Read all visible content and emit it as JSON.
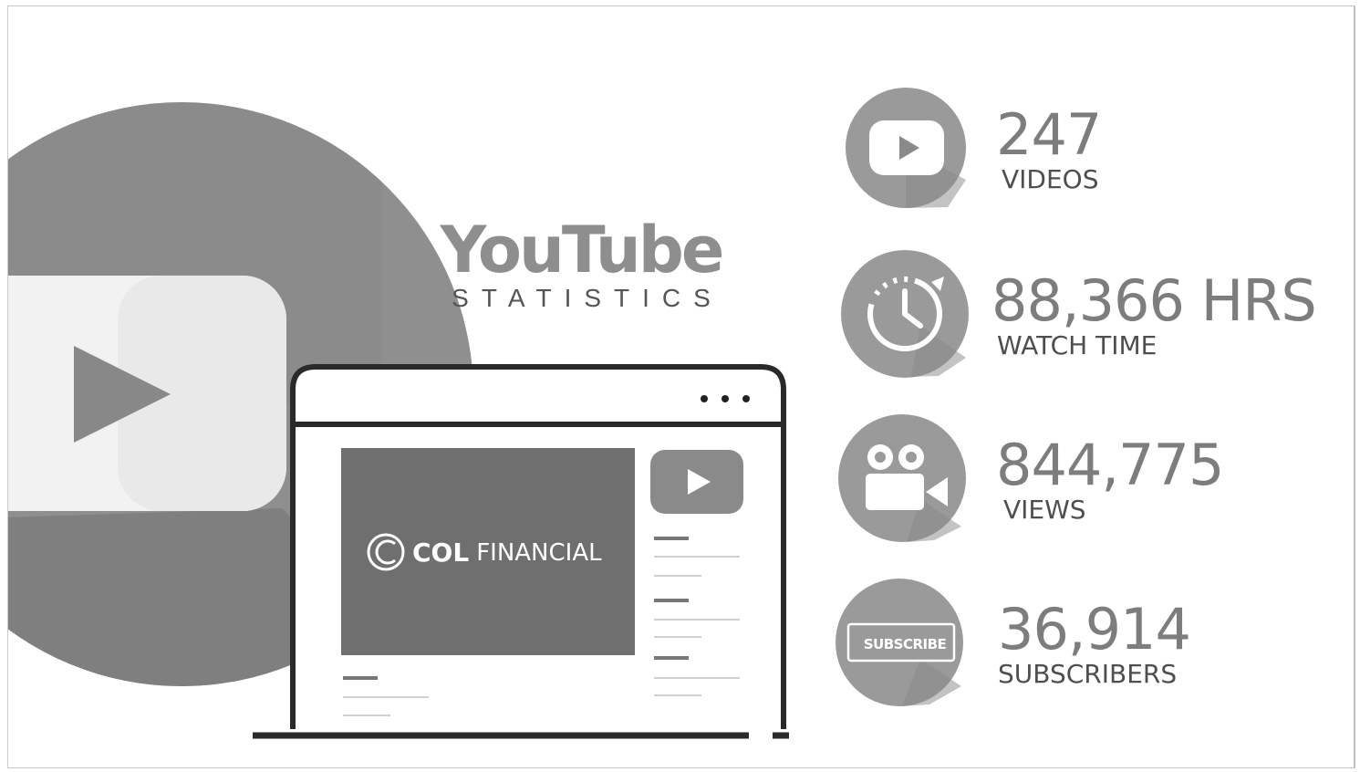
{
  "header": {
    "title": "YouTube",
    "subtitle": "STATISTICS"
  },
  "video_player": {
    "brand_strong": "COL",
    "brand_rest": "FINANCIAL"
  },
  "stats": [
    {
      "value": "247",
      "label": "VIDEOS",
      "icon": "youtube-play-icon"
    },
    {
      "value": "88,366 HRS",
      "label": "WATCH TIME",
      "icon": "clock-refresh-icon"
    },
    {
      "value": "844,775",
      "label": "VIEWS",
      "icon": "video-camera-icon"
    },
    {
      "value": "36,914",
      "label": "SUBSCRIBERS",
      "icon": "subscribe-icon"
    }
  ],
  "subscribe_badge": "SUBSCRIBE",
  "colors": {
    "big_circle": "#8f8f8f",
    "icon_circle": "#9a9a9a",
    "player_screen": "#6f6f6f",
    "text_value": "#7d7d7d",
    "text_label": "#4e4e4e"
  }
}
